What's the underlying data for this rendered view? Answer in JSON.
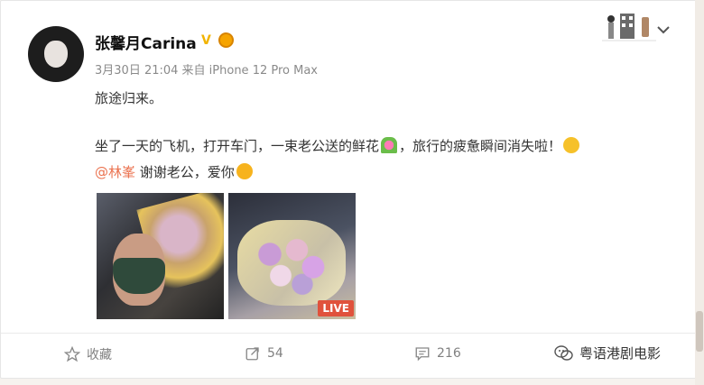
{
  "post": {
    "username": "张馨月Carina",
    "verified_mark": "V",
    "meta": "3月30日 21:04 来自 iPhone 12 Pro Max",
    "line1": "旅途归来。",
    "line2a": "坐了一天的飞机，打开车门，一束老公送的鲜花",
    "line2b": "，旅行的疲惫瞬间消失啦！",
    "mention": "@林峯",
    "line3": " 谢谢老公，爱你",
    "live_label": "LIVE"
  },
  "actions": {
    "collect_label": "收藏",
    "repost_count": "54",
    "comment_count": "216"
  },
  "watermark": {
    "text": "粤语港剧电影"
  },
  "icons": [
    "star-icon",
    "repost-icon",
    "comment-icon",
    "chevron-down-icon",
    "wechat-logo-icon"
  ],
  "colors": {
    "mention": "#eb7350",
    "live_badge": "#e0523c",
    "verified": "#f2b400"
  }
}
